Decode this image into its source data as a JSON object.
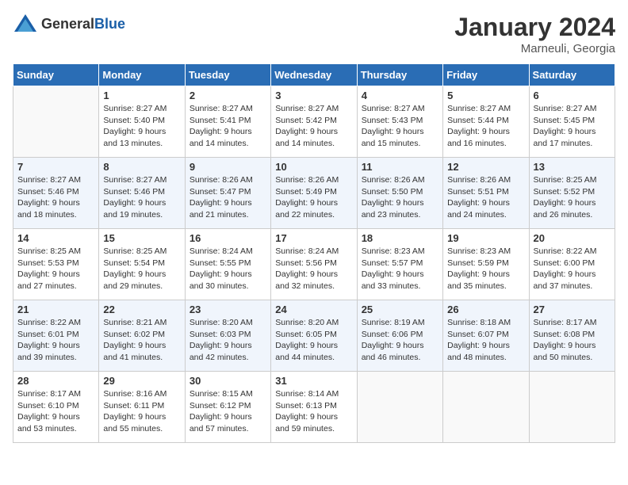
{
  "logo": {
    "general": "General",
    "blue": "Blue"
  },
  "title": "January 2024",
  "location": "Marneuli, Georgia",
  "days_of_week": [
    "Sunday",
    "Monday",
    "Tuesday",
    "Wednesday",
    "Thursday",
    "Friday",
    "Saturday"
  ],
  "weeks": [
    [
      {
        "day": "",
        "sunrise": "",
        "sunset": "",
        "daylight": ""
      },
      {
        "day": "1",
        "sunrise": "Sunrise: 8:27 AM",
        "sunset": "Sunset: 5:40 PM",
        "daylight": "Daylight: 9 hours and 13 minutes."
      },
      {
        "day": "2",
        "sunrise": "Sunrise: 8:27 AM",
        "sunset": "Sunset: 5:41 PM",
        "daylight": "Daylight: 9 hours and 14 minutes."
      },
      {
        "day": "3",
        "sunrise": "Sunrise: 8:27 AM",
        "sunset": "Sunset: 5:42 PM",
        "daylight": "Daylight: 9 hours and 14 minutes."
      },
      {
        "day": "4",
        "sunrise": "Sunrise: 8:27 AM",
        "sunset": "Sunset: 5:43 PM",
        "daylight": "Daylight: 9 hours and 15 minutes."
      },
      {
        "day": "5",
        "sunrise": "Sunrise: 8:27 AM",
        "sunset": "Sunset: 5:44 PM",
        "daylight": "Daylight: 9 hours and 16 minutes."
      },
      {
        "day": "6",
        "sunrise": "Sunrise: 8:27 AM",
        "sunset": "Sunset: 5:45 PM",
        "daylight": "Daylight: 9 hours and 17 minutes."
      }
    ],
    [
      {
        "day": "7",
        "sunrise": "Sunrise: 8:27 AM",
        "sunset": "Sunset: 5:46 PM",
        "daylight": "Daylight: 9 hours and 18 minutes."
      },
      {
        "day": "8",
        "sunrise": "Sunrise: 8:27 AM",
        "sunset": "Sunset: 5:46 PM",
        "daylight": "Daylight: 9 hours and 19 minutes."
      },
      {
        "day": "9",
        "sunrise": "Sunrise: 8:26 AM",
        "sunset": "Sunset: 5:47 PM",
        "daylight": "Daylight: 9 hours and 21 minutes."
      },
      {
        "day": "10",
        "sunrise": "Sunrise: 8:26 AM",
        "sunset": "Sunset: 5:49 PM",
        "daylight": "Daylight: 9 hours and 22 minutes."
      },
      {
        "day": "11",
        "sunrise": "Sunrise: 8:26 AM",
        "sunset": "Sunset: 5:50 PM",
        "daylight": "Daylight: 9 hours and 23 minutes."
      },
      {
        "day": "12",
        "sunrise": "Sunrise: 8:26 AM",
        "sunset": "Sunset: 5:51 PM",
        "daylight": "Daylight: 9 hours and 24 minutes."
      },
      {
        "day": "13",
        "sunrise": "Sunrise: 8:25 AM",
        "sunset": "Sunset: 5:52 PM",
        "daylight": "Daylight: 9 hours and 26 minutes."
      }
    ],
    [
      {
        "day": "14",
        "sunrise": "Sunrise: 8:25 AM",
        "sunset": "Sunset: 5:53 PM",
        "daylight": "Daylight: 9 hours and 27 minutes."
      },
      {
        "day": "15",
        "sunrise": "Sunrise: 8:25 AM",
        "sunset": "Sunset: 5:54 PM",
        "daylight": "Daylight: 9 hours and 29 minutes."
      },
      {
        "day": "16",
        "sunrise": "Sunrise: 8:24 AM",
        "sunset": "Sunset: 5:55 PM",
        "daylight": "Daylight: 9 hours and 30 minutes."
      },
      {
        "day": "17",
        "sunrise": "Sunrise: 8:24 AM",
        "sunset": "Sunset: 5:56 PM",
        "daylight": "Daylight: 9 hours and 32 minutes."
      },
      {
        "day": "18",
        "sunrise": "Sunrise: 8:23 AM",
        "sunset": "Sunset: 5:57 PM",
        "daylight": "Daylight: 9 hours and 33 minutes."
      },
      {
        "day": "19",
        "sunrise": "Sunrise: 8:23 AM",
        "sunset": "Sunset: 5:59 PM",
        "daylight": "Daylight: 9 hours and 35 minutes."
      },
      {
        "day": "20",
        "sunrise": "Sunrise: 8:22 AM",
        "sunset": "Sunset: 6:00 PM",
        "daylight": "Daylight: 9 hours and 37 minutes."
      }
    ],
    [
      {
        "day": "21",
        "sunrise": "Sunrise: 8:22 AM",
        "sunset": "Sunset: 6:01 PM",
        "daylight": "Daylight: 9 hours and 39 minutes."
      },
      {
        "day": "22",
        "sunrise": "Sunrise: 8:21 AM",
        "sunset": "Sunset: 6:02 PM",
        "daylight": "Daylight: 9 hours and 41 minutes."
      },
      {
        "day": "23",
        "sunrise": "Sunrise: 8:20 AM",
        "sunset": "Sunset: 6:03 PM",
        "daylight": "Daylight: 9 hours and 42 minutes."
      },
      {
        "day": "24",
        "sunrise": "Sunrise: 8:20 AM",
        "sunset": "Sunset: 6:05 PM",
        "daylight": "Daylight: 9 hours and 44 minutes."
      },
      {
        "day": "25",
        "sunrise": "Sunrise: 8:19 AM",
        "sunset": "Sunset: 6:06 PM",
        "daylight": "Daylight: 9 hours and 46 minutes."
      },
      {
        "day": "26",
        "sunrise": "Sunrise: 8:18 AM",
        "sunset": "Sunset: 6:07 PM",
        "daylight": "Daylight: 9 hours and 48 minutes."
      },
      {
        "day": "27",
        "sunrise": "Sunrise: 8:17 AM",
        "sunset": "Sunset: 6:08 PM",
        "daylight": "Daylight: 9 hours and 50 minutes."
      }
    ],
    [
      {
        "day": "28",
        "sunrise": "Sunrise: 8:17 AM",
        "sunset": "Sunset: 6:10 PM",
        "daylight": "Daylight: 9 hours and 53 minutes."
      },
      {
        "day": "29",
        "sunrise": "Sunrise: 8:16 AM",
        "sunset": "Sunset: 6:11 PM",
        "daylight": "Daylight: 9 hours and 55 minutes."
      },
      {
        "day": "30",
        "sunrise": "Sunrise: 8:15 AM",
        "sunset": "Sunset: 6:12 PM",
        "daylight": "Daylight: 9 hours and 57 minutes."
      },
      {
        "day": "31",
        "sunrise": "Sunrise: 8:14 AM",
        "sunset": "Sunset: 6:13 PM",
        "daylight": "Daylight: 9 hours and 59 minutes."
      },
      {
        "day": "",
        "sunrise": "",
        "sunset": "",
        "daylight": ""
      },
      {
        "day": "",
        "sunrise": "",
        "sunset": "",
        "daylight": ""
      },
      {
        "day": "",
        "sunrise": "",
        "sunset": "",
        "daylight": ""
      }
    ]
  ]
}
